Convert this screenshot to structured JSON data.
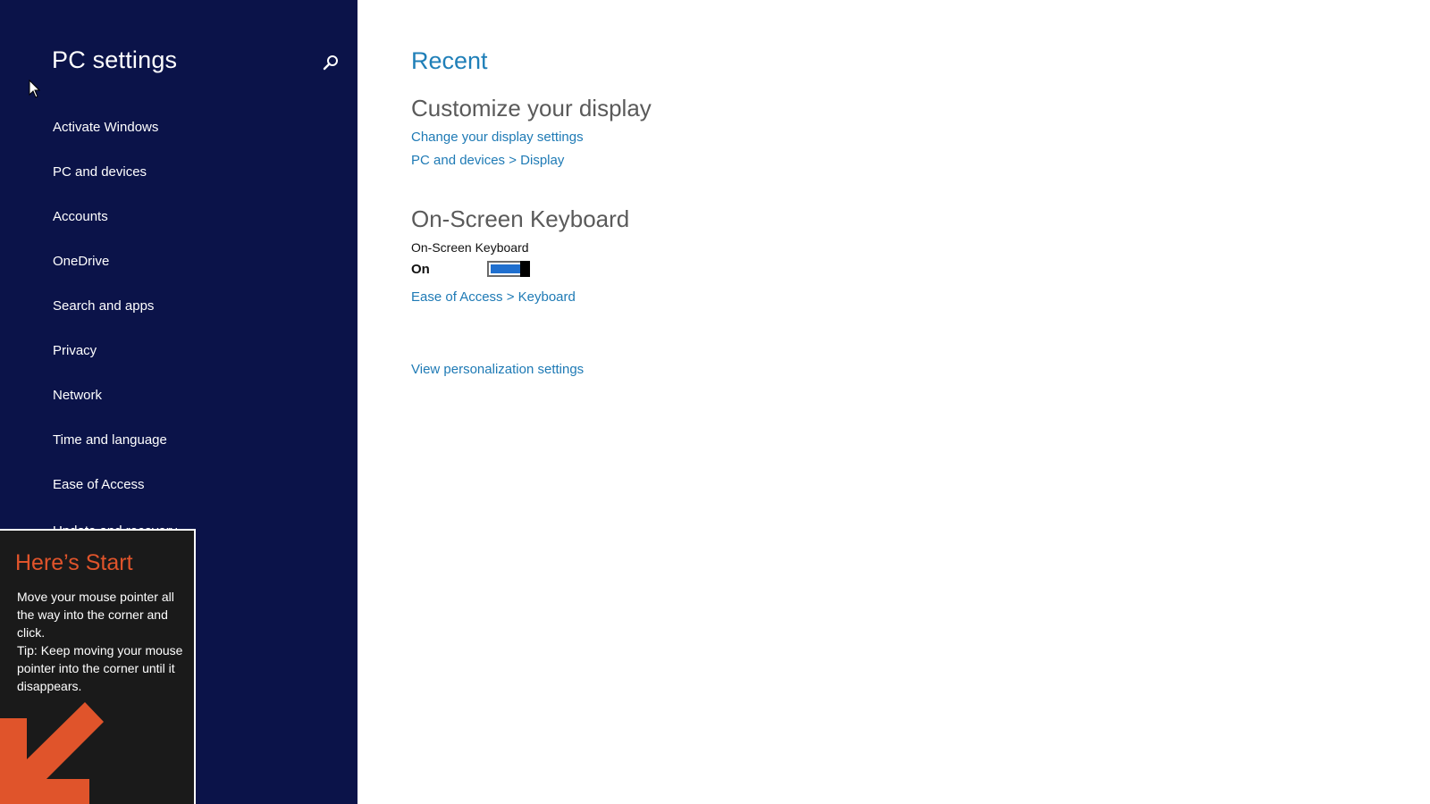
{
  "nav": {
    "title": "PC settings",
    "search_icon": "search-icon",
    "items": [
      {
        "label": "Activate Windows"
      },
      {
        "label": "PC and devices"
      },
      {
        "label": "Accounts"
      },
      {
        "label": "OneDrive"
      },
      {
        "label": "Search and apps"
      },
      {
        "label": "Privacy"
      },
      {
        "label": "Network"
      },
      {
        "label": "Time and language"
      },
      {
        "label": "Ease of Access"
      },
      {
        "label": "Update and recovery"
      }
    ]
  },
  "main": {
    "recent_heading": "Recent",
    "display": {
      "heading": "Customize your display",
      "link": "Change your display settings",
      "path": "PC and devices > Display"
    },
    "keyboard": {
      "heading": "On-Screen Keyboard",
      "setting_label": "On-Screen Keyboard",
      "state": "On",
      "toggle_on": true,
      "path": "Ease of Access > Keyboard"
    },
    "personalization_link": "View personalization settings"
  },
  "tip": {
    "title": "Here’s Start",
    "line1": "Move your mouse pointer all the way into the corner and click.",
    "line2": "Tip: Keep moving your mouse pointer into the corner until it disappears.",
    "arrow_icon": "arrow-down-left-icon"
  },
  "colors": {
    "nav_bg": "#0b1349",
    "accent_link": "#1e7ab5",
    "tip_title": "#e0542b",
    "toggle_fill": "#1f6fcf"
  }
}
